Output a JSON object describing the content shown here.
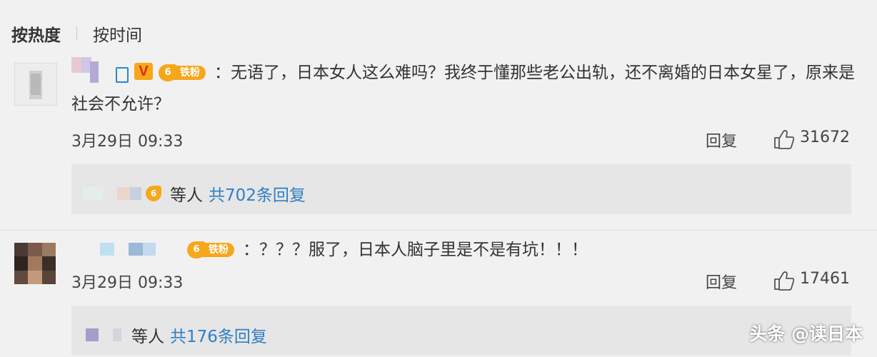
{
  "sort": {
    "hot": "按热度",
    "time": "按时间"
  },
  "comments": [
    {
      "text": "：无语了，日本女人这么难吗？我终于懂那些老公出轨，还不离婚的日本女星了，原来是社会不允许？",
      "badge": "铁粉",
      "badge_level": "6",
      "verified": "V",
      "date": "3月29日 09:33",
      "reply_label": "回复",
      "likes": "31672",
      "replies": {
        "suffix": "等人",
        "link": "共702条回复",
        "badge_level": "6"
      }
    },
    {
      "text": "：？？？服了，日本人脑子里是不是有坑！！！",
      "badge": "铁粉",
      "badge_level": "6",
      "date": "3月29日 09:33",
      "reply_label": "回复",
      "likes": "17461",
      "replies": {
        "suffix": "等人",
        "link": "共176条回复"
      }
    }
  ],
  "watermark": "头条 @读日本",
  "colors": {
    "link": "#2f7fc5",
    "badge": "#f7a61c",
    "background": "#f1f1f1"
  }
}
